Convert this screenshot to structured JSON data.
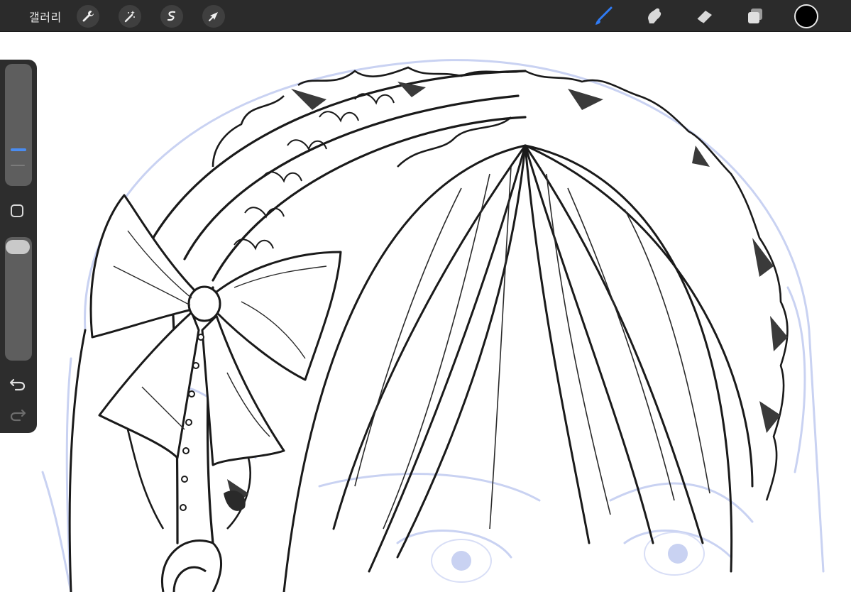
{
  "toolbar": {
    "gallery_label": "갤러리",
    "left_tools": [
      "actions-wrench",
      "adjustments-wand",
      "selection",
      "transform-arrow"
    ],
    "right_tools": [
      "brush",
      "smudge",
      "eraser",
      "layers"
    ],
    "active_tool": "brush",
    "accent_color": "#2f7bf5",
    "current_color": "#000000"
  },
  "sidebar": {
    "brush_size_slider": "brush-size",
    "opacity_slider": "brush-opacity",
    "modify_button": "square-icon",
    "undo": "undo-icon",
    "redo": "redo-icon"
  },
  "canvas": {
    "background": "#ffffff",
    "sketch_color": "#c9d2f2",
    "line_color": "#1a1a1a"
  }
}
